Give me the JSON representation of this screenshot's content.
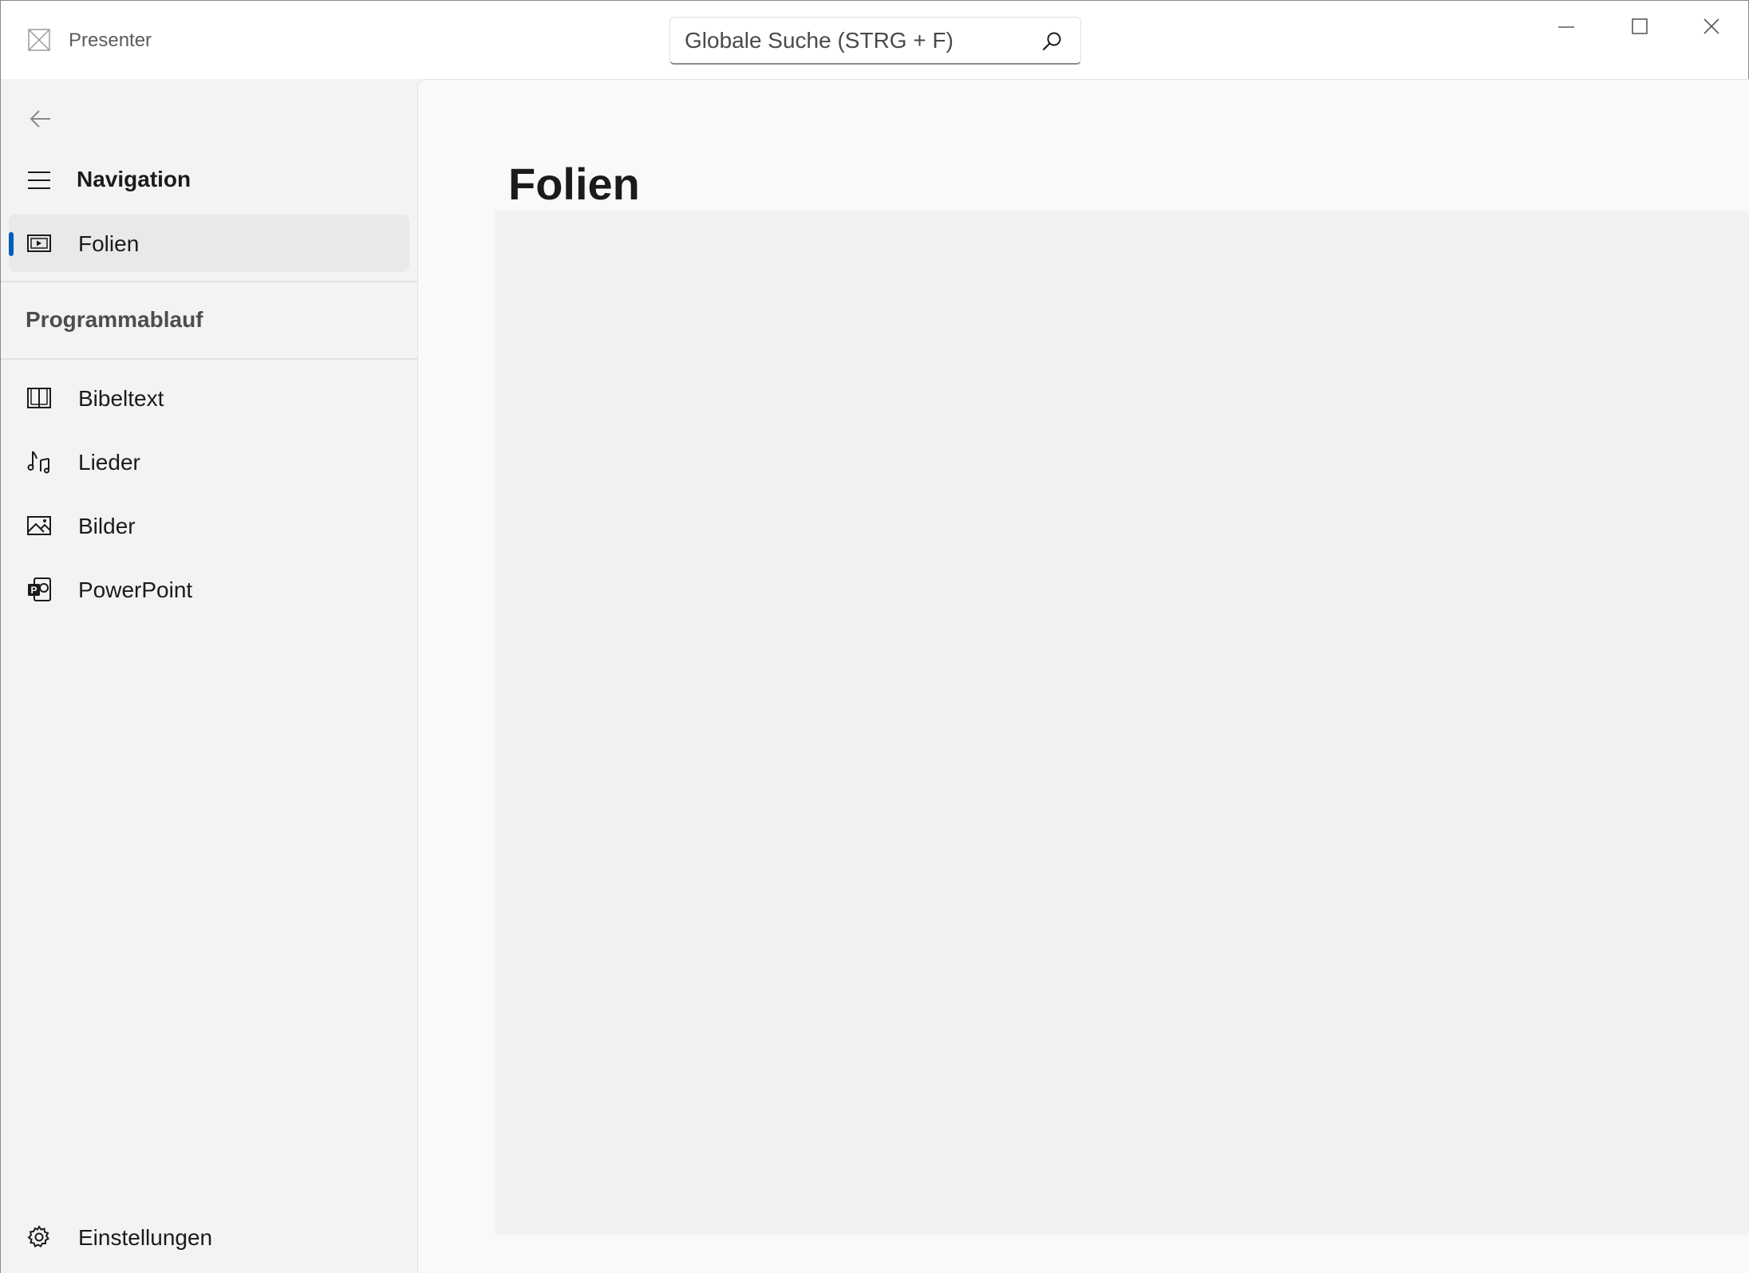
{
  "titlebar": {
    "app_title": "Presenter",
    "app_icon": "app-placeholder-icon",
    "search": {
      "placeholder": "Globale Suche (STRG + F)",
      "value": "",
      "icon": "search-icon"
    },
    "caption_buttons": [
      "minimize-icon",
      "maximize-icon",
      "close-icon"
    ]
  },
  "sidebar": {
    "back_icon": "back-arrow-icon",
    "menu_icon": "hamburger-icon",
    "title": "Navigation",
    "top_items": [
      {
        "label": "Folien",
        "icon": "slides-icon",
        "selected": true
      }
    ],
    "section_header": "Programmablauf",
    "items": [
      {
        "label": "Bibeltext",
        "icon": "book-icon"
      },
      {
        "label": "Lieder",
        "icon": "music-note-icon"
      },
      {
        "label": "Bilder",
        "icon": "image-icon"
      },
      {
        "label": "PowerPoint",
        "icon": "powerpoint-icon"
      }
    ],
    "footer_item": {
      "label": "Einstellungen",
      "icon": "gear-icon"
    }
  },
  "main": {
    "page_title": "Folien"
  },
  "colors": {
    "accent": "#005fb8",
    "sidebar_bg": "#f3f3f3",
    "content_bg": "#f9f9f9",
    "selected_bg": "#e9e9e9"
  }
}
